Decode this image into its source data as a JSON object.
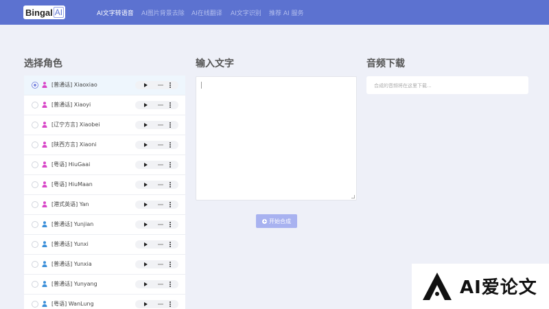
{
  "brand": {
    "name": "Bingal",
    "ai": "AI"
  },
  "nav": {
    "items": [
      {
        "label": "AI文字转语音",
        "active": true
      },
      {
        "label": "AI图片背景去除",
        "active": false
      },
      {
        "label": "AI在线翻译",
        "active": false
      },
      {
        "label": "AI文字识别",
        "active": false
      },
      {
        "label": "推荐 AI 服务",
        "active": false
      }
    ]
  },
  "roles": {
    "title": "选择角色",
    "items": [
      {
        "label": "[普通话] Xiaoxiao",
        "gender": "female",
        "selected": true
      },
      {
        "label": "[普通话] Xiaoyi",
        "gender": "female",
        "selected": false
      },
      {
        "label": "[辽宁方言] Xiaobei",
        "gender": "female",
        "selected": false
      },
      {
        "label": "[陕西方言] Xiaoni",
        "gender": "female",
        "selected": false
      },
      {
        "label": "[粤语] HiuGaai",
        "gender": "female",
        "selected": false
      },
      {
        "label": "[粤语] HiuMaan",
        "gender": "female",
        "selected": false
      },
      {
        "label": "[港式英语] Yan",
        "gender": "female",
        "selected": false
      },
      {
        "label": "[普通话] Yunjian",
        "gender": "male",
        "selected": false
      },
      {
        "label": "[普通话] Yunxi",
        "gender": "male",
        "selected": false
      },
      {
        "label": "[普通话] Yunxia",
        "gender": "male",
        "selected": false
      },
      {
        "label": "[普通话] Yunyang",
        "gender": "male",
        "selected": false
      },
      {
        "label": "[粤语] WanLung",
        "gender": "male",
        "selected": false
      }
    ]
  },
  "input": {
    "title": "输入文字",
    "value": ""
  },
  "synthesize_button": {
    "label": "开始合成",
    "icon": "plus-circle-icon"
  },
  "download": {
    "title": "音频下载",
    "placeholder": "合成的音频将在这里下载..."
  },
  "watermark": {
    "text": "AI爱论文"
  },
  "colors": {
    "navbar": "#5c72d0",
    "female_icon": "#d946c8",
    "male_icon": "#3b8fd9",
    "button": "#a8b2f0",
    "background": "#eef0f8"
  }
}
